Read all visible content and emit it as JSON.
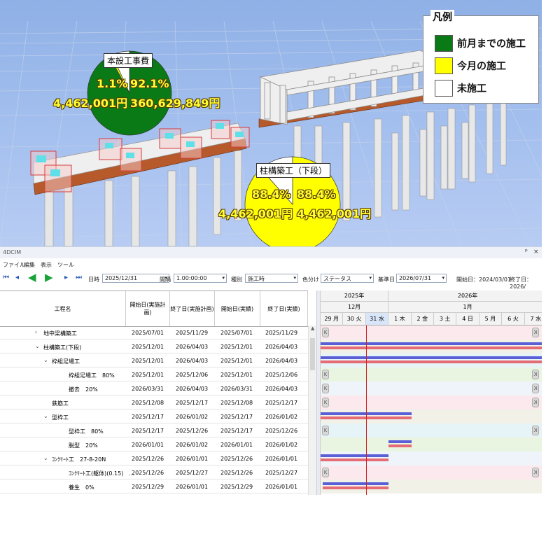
{
  "scene": {
    "legend": {
      "title": "凡例",
      "items": [
        {
          "label": "前月までの施工",
          "color": "#0a7a16"
        },
        {
          "label": "今月の施工",
          "color": "#ffff00"
        },
        {
          "label": "未施工",
          "color": "#ffffff"
        }
      ]
    },
    "pies": [
      {
        "label": "本設工事費",
        "pct_left": "1.1%",
        "pct_right": "92.1%",
        "amount_left": "4,462,001円",
        "amount_right": "360,629,849円",
        "slices": {
          "previous": 0.921,
          "current": 0.011,
          "remaining": 0.068
        }
      },
      {
        "label": "柱構築工（下段）",
        "pct_left": "88.4%",
        "pct_right": "88.4%",
        "amount_left": "4,462,001円",
        "amount_right": "4,462,001円",
        "slices": {
          "previous": 0.0,
          "current": 0.884,
          "remaining": 0.116
        }
      }
    ]
  },
  "app": {
    "title": "4DCIM",
    "window_controls": [
      "ᵖ",
      "×"
    ],
    "menu": [
      "ファイル",
      "編集",
      "表示",
      "ツール"
    ]
  },
  "toolbar": {
    "nav": [
      "first-icon",
      "prev-icon",
      "play-back-icon",
      "play-icon",
      "next-icon",
      "last-icon"
    ],
    "date_label": "日時",
    "date_value": "2025/12/31",
    "interval_label": "間隔",
    "interval_value": "1.00:00:00",
    "type_label": "種別",
    "type_value": "施工時",
    "color_label": "色分け",
    "color_value": "ステータス",
    "base_label": "基準日",
    "base_value": "2026/07/31",
    "start_info": "開始日：2024/03/01",
    "end_info": "終了日：2026/"
  },
  "grid": {
    "columns": [
      "工程名",
      "開始日(実施計画)",
      "終了日(実施計画)",
      "開始日(実績)",
      "終了日(実績)"
    ],
    "rows": [
      {
        "name": "地中梁構築工",
        "indent": 1,
        "chev": "›",
        "plan_start": "2025/07/01",
        "plan_end": "2025/11/29",
        "act_start": "2025/07/01",
        "act_end": "2025/11/29"
      },
      {
        "name": "柱構築工(下段)",
        "indent": 1,
        "chev": "⌄",
        "plan_start": "2025/12/01",
        "plan_end": "2026/04/03",
        "act_start": "2025/12/01",
        "act_end": "2026/04/03"
      },
      {
        "name": "枠組足場工",
        "indent": 2,
        "chev": "⌄",
        "plan_start": "2025/12/01",
        "plan_end": "2026/04/03",
        "act_start": "2025/12/01",
        "act_end": "2026/04/03"
      },
      {
        "name": "枠組足場工　80%",
        "indent": 3,
        "chev": "",
        "plan_start": "2025/12/01",
        "plan_end": "2025/12/06",
        "act_start": "2025/12/01",
        "act_end": "2025/12/06"
      },
      {
        "name": "撤去　20%",
        "indent": 3,
        "chev": "",
        "plan_start": "2026/03/31",
        "plan_end": "2026/04/03",
        "act_start": "2026/03/31",
        "act_end": "2026/04/03"
      },
      {
        "name": "鉄筋工",
        "indent": 2,
        "chev": "",
        "plan_start": "2025/12/08",
        "plan_end": "2025/12/17",
        "act_start": "2025/12/08",
        "act_end": "2025/12/17"
      },
      {
        "name": "型枠工",
        "indent": 2,
        "chev": "⌄",
        "plan_start": "2025/12/17",
        "plan_end": "2026/01/02",
        "act_start": "2025/12/17",
        "act_end": "2026/01/02"
      },
      {
        "name": "型枠工　80%",
        "indent": 3,
        "chev": "",
        "plan_start": "2025/12/17",
        "plan_end": "2025/12/26",
        "act_start": "2025/12/17",
        "act_end": "2025/12/26"
      },
      {
        "name": "脱型　20%",
        "indent": 3,
        "chev": "",
        "plan_start": "2026/01/01",
        "plan_end": "2026/01/02",
        "act_start": "2026/01/01",
        "act_end": "2026/01/02"
      },
      {
        "name": "ｺﾝｸﾘｰﾄ工　27-8-20N",
        "indent": 2,
        "chev": "⌄",
        "plan_start": "2025/12/26",
        "plan_end": "2026/01/01",
        "act_start": "2025/12/26",
        "act_end": "2026/01/01"
      },
      {
        "name": "ｺﾝｸﾘｰﾄ工(躯体)(0.15)　…",
        "indent": 3,
        "chev": "",
        "plan_start": "2025/12/26",
        "plan_end": "2025/12/27",
        "act_start": "2025/12/26",
        "act_end": "2025/12/27"
      },
      {
        "name": "養生　0%",
        "indent": 3,
        "chev": "",
        "plan_start": "2025/12/29",
        "plan_end": "2026/01/01",
        "act_start": "2025/12/29",
        "act_end": "2026/01/01"
      }
    ]
  },
  "gantt": {
    "years": [
      {
        "label": "2025年",
        "span": 3
      },
      {
        "label": "2026年",
        "span": 7
      }
    ],
    "months": [
      {
        "label": "12月",
        "span": 3
      },
      {
        "label": "1月",
        "span": 7
      }
    ],
    "days": [
      "29 月",
      "30 火",
      "31 水",
      "1 木",
      "2 金",
      "3 土",
      "4 日",
      "5 月",
      "6 火",
      "7 水"
    ],
    "today_index": 2,
    "plan_color": "#5a5fd8",
    "actual_color": "#e56b74",
    "rows": [
      {
        "k_left": true,
        "k_right": true,
        "bars": []
      },
      {
        "k_left": false,
        "k_right": false,
        "bars": [
          {
            "from": 0,
            "to": 10
          }
        ]
      },
      {
        "k_left": false,
        "k_right": false,
        "bars": [
          {
            "from": 0,
            "to": 10
          }
        ]
      },
      {
        "k_left": true,
        "k_right": true,
        "bars": []
      },
      {
        "k_left": true,
        "k_right": true,
        "bars": []
      },
      {
        "k_left": true,
        "k_right": true,
        "bars": []
      },
      {
        "k_left": false,
        "k_right": false,
        "bars": [
          {
            "from": 0,
            "to": 4
          }
        ]
      },
      {
        "k_left": true,
        "k_right": true,
        "bars": []
      },
      {
        "k_left": false,
        "k_right": false,
        "bars": [
          {
            "from": 3,
            "to": 4
          }
        ]
      },
      {
        "k_left": false,
        "k_right": false,
        "bars": [
          {
            "from": 0,
            "to": 3
          }
        ]
      },
      {
        "k_left": true,
        "k_right": true,
        "bars": []
      },
      {
        "k_left": false,
        "k_right": false,
        "bars": [
          {
            "from": 0.1,
            "to": 3
          }
        ]
      }
    ],
    "band_colors": [
      "#fbe9ee",
      "#f1f1e8",
      "#e6f3f7",
      "#e9f5e0",
      "#eef4fa"
    ]
  }
}
